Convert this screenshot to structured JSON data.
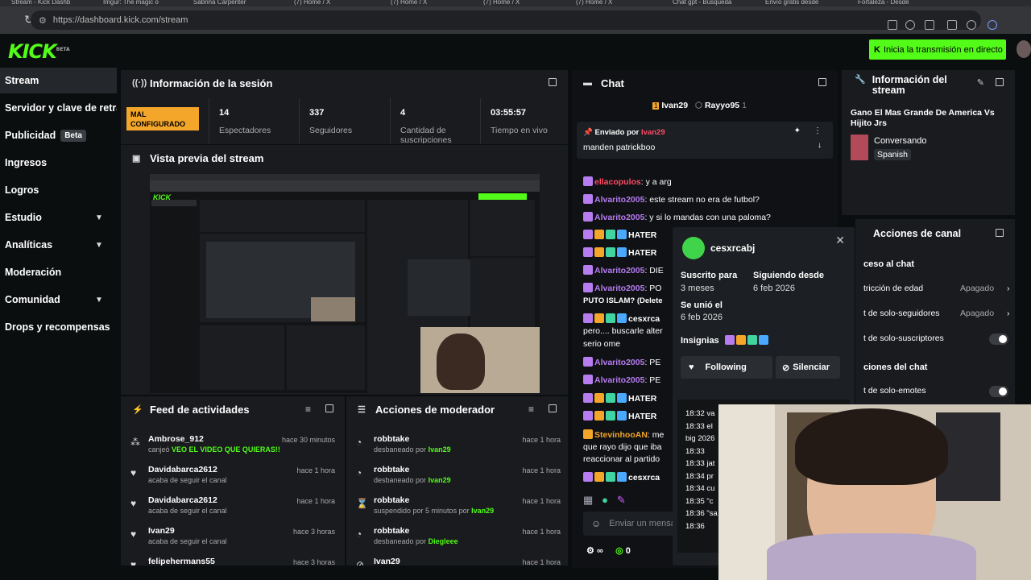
{
  "browser": {
    "tabs": [
      "Stream - Kick Dashb",
      "Imgur: The magic o",
      "Sabrina Carpenter",
      "(7) Home / X",
      "(7) Home / X",
      "(7) Home / X",
      "(7) Home / X",
      "Chat gpt - Búsqueda",
      "Envío gratis desde",
      "Fortaleza - Desde"
    ],
    "url": "https://dashboard.kick.com/stream"
  },
  "header": {
    "logo": "KICK",
    "logo_tag": "BETA",
    "go_live_label": "Inicia la transmisión en directo"
  },
  "sidebar": {
    "items": [
      {
        "label": "Stream"
      },
      {
        "label": "Servidor y clave de retransmisión"
      },
      {
        "label": "Publicidad",
        "badge": "Beta"
      },
      {
        "label": "Ingresos"
      },
      {
        "label": "Logros"
      },
      {
        "label": "Estudio"
      },
      {
        "label": "Analíticas"
      },
      {
        "label": "Moderación"
      },
      {
        "label": "Comunidad"
      },
      {
        "label": "Drops y recompensas"
      }
    ]
  },
  "session": {
    "title": "Información de la sesión",
    "status": "MAL CONFIGURADO",
    "stats": [
      {
        "value": "14",
        "label": "Espectadores"
      },
      {
        "value": "337",
        "label": "Seguidores"
      },
      {
        "value": "4",
        "label": "Cantidad de suscripciones"
      },
      {
        "value": "03:55:57",
        "label": "Tiempo en vivo"
      }
    ]
  },
  "preview": {
    "title": "Vista previa del stream"
  },
  "activity": {
    "title": "Feed de actividades",
    "items": [
      {
        "name": "Ambrose_912",
        "desc_prefix": "canjeó",
        "desc_hl": "VEO EL VIDEO QUE QUIERAS!!",
        "time": "hace 30 minutos",
        "icon": "redeem-icon"
      },
      {
        "name": "Davidabarca2612",
        "desc_prefix": "acaba de seguir el canal",
        "desc_hl": "",
        "time": "hace 1 hora",
        "icon": "heart-icon"
      },
      {
        "name": "Davidabarca2612",
        "desc_prefix": "acaba de seguir el canal",
        "desc_hl": "",
        "time": "hace 1 hora",
        "icon": "heart-icon"
      },
      {
        "name": "Ivan29",
        "desc_prefix": "acaba de seguir el canal",
        "desc_hl": "",
        "time": "hace 3 horas",
        "icon": "heart-icon"
      },
      {
        "name": "felipehermans55",
        "desc_prefix": "",
        "desc_hl": "",
        "time": "hace 3 horas",
        "icon": "heart-icon"
      }
    ]
  },
  "moderator": {
    "title": "Acciones de moderador",
    "items": [
      {
        "name": "robbtake",
        "desc_prefix": "desbaneado por",
        "desc_hl": "Ivan29",
        "time": "hace 1 hora",
        "icon": "unban-icon"
      },
      {
        "name": "robbtake",
        "desc_prefix": "desbaneado por",
        "desc_hl": "Ivan29",
        "time": "hace 1 hora",
        "icon": "unban-icon"
      },
      {
        "name": "robbtake",
        "desc_prefix": "suspendido por 5 minutos por",
        "desc_hl": "Ivan29",
        "time": "hace 1 hora",
        "icon": "hourglass-icon"
      },
      {
        "name": "robbtake",
        "desc_prefix": "desbaneado por",
        "desc_hl": "Diegleee",
        "time": "hace 1 hora",
        "icon": "unban-icon"
      },
      {
        "name": "Ivan29",
        "desc_prefix": "",
        "desc_hl": "",
        "time": "hace 1 hora",
        "icon": "timeout-icon"
      }
    ]
  },
  "chat": {
    "title": "Chat",
    "top_users": [
      "Ivan29",
      "Rayyo95"
    ],
    "top_rank": [
      "1",
      "1"
    ],
    "pinned_label": "Enviado por",
    "pinned_user": "Ivan29",
    "pinned_message": "manden patrickboo",
    "messages": [
      {
        "user": "ellacopulos",
        "text": ": y a arg",
        "color": "re"
      },
      {
        "user": "Alvarito2005",
        "text": ": este stream no era de futbol?",
        "color": "pu"
      },
      {
        "user": "Alvarito2005",
        "text": ": y si lo mandas con una paloma?",
        "color": "pu"
      },
      {
        "user": "HATER",
        "text": "",
        "color": ""
      },
      {
        "user": "HATER",
        "text": "",
        "color": ""
      },
      {
        "user": "Alvarito2005",
        "text": ": DIE",
        "color": "pu"
      },
      {
        "user": "Alvarito2005",
        "text": ": PO",
        "color": "pu"
      },
      {
        "user": "PUTO ISLAM? (Delete",
        "text": "",
        "color": ""
      },
      {
        "user": "cesxrca",
        "text": "",
        "color": ""
      },
      {
        "user": "pero.... buscarle alter",
        "text": "",
        "color": ""
      },
      {
        "user": "serio ome",
        "text": "",
        "color": ""
      },
      {
        "user": "Alvarito2005",
        "text": ": PE",
        "color": "pu"
      },
      {
        "user": "Alvarito2005",
        "text": ": PE",
        "color": "pu"
      },
      {
        "user": "HATER",
        "text": "",
        "color": ""
      },
      {
        "user": "HATER",
        "text": "",
        "color": ""
      },
      {
        "user": "StevinhooAN",
        "text": ": me",
        "color": "or"
      },
      {
        "user": "que rayo dijo que iba",
        "text": "",
        "color": ""
      },
      {
        "user": "reaccionar al partido",
        "text": "",
        "color": ""
      },
      {
        "user": "cesxrca",
        "text": "",
        "color": ""
      }
    ],
    "input_placeholder": "Enviar un mensaje",
    "points": "0",
    "points_icon": "∞"
  },
  "user_card": {
    "username": "cesxrcabj",
    "sub_label": "Suscrito para",
    "sub_value": "3 meses",
    "follow_label": "Siguiendo desde",
    "follow_value": "6 feb 2026",
    "joined_label": "Se unió el",
    "joined_value": "6 feb 2026",
    "badges_label": "Insignias",
    "following_btn": "Following",
    "mute_btn": "Silenciar",
    "log": [
      "18:32 va",
      "18:33 el",
      "big 2026",
      "18:33",
      "18:33 jat",
      "18:34 pr",
      "18:34 cu",
      "18:35 \"c",
      "18:36 \"sa",
      "18:36"
    ]
  },
  "stream_info": {
    "title": "Información del stream",
    "stream_title": "Gano El Mas Grande De America Vs Hijito Jrs",
    "category": "Conversando",
    "language": "Spanish"
  },
  "channel_actions": {
    "title": "Acciones de canal",
    "section1": "ceso al chat",
    "rows": [
      {
        "label": "tricción de edad",
        "value": "Apagado"
      },
      {
        "label": "t de solo-seguidores",
        "value": "Apagado"
      },
      {
        "label": "t de solo-suscriptores",
        "value": ""
      }
    ],
    "section2": "ciones del chat",
    "rows2": [
      {
        "label": "t de solo-emotes",
        "value": ""
      }
    ]
  },
  "colors": {
    "brand": "#53fc18",
    "warning": "#f4a62a",
    "panel": "#191b1f",
    "bg": "#0b0e0f"
  }
}
